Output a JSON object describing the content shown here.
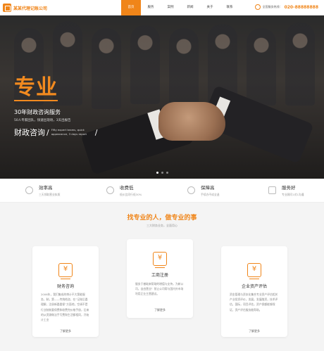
{
  "header": {
    "logo_text": "某某代理记账公司",
    "nav": [
      "首页",
      "服务",
      "案例",
      "新闻",
      "关于",
      "联系"
    ],
    "phone_label": "全国服务热线：",
    "phone_number": "020-88888888"
  },
  "banner": {
    "big_title": "专业",
    "line1": "30年财政咨询服务",
    "line2": "50人专家团队，快速出现场，3天出报告",
    "line3": "财政咨询",
    "side_note": "Fifty expert teams, quick appearance, 3 days report",
    "accent_color": "#f28a1f"
  },
  "features": [
    {
      "title": "效率高",
      "sub": "三天领取营业执照"
    },
    {
      "title": "收费低",
      "sub": "低价比同行低30%"
    },
    {
      "title": "保障高",
      "sub": "手续办不成全退"
    },
    {
      "title": "服务好",
      "sub": "专业顾问1对1沟通"
    }
  ],
  "section": {
    "title": "找专业的人，做专业的事",
    "subtitle": "三大财务业务，全面用心"
  },
  "cards": [
    {
      "title": "财务咨询",
      "desc": "2006年，我们集成的审计不大第能服务，制，第——传统地咨，在“记账后委理解，注册新委委保”方面地，空调不是行业制前委保费和收费完价格手册，后来的从资源做法手写费和生活都相同，开始计工业",
      "link": "了解更多"
    },
    {
      "title": "工商注册",
      "desc": "服务于基础来帮助的增值与支持，为新公司，自由营业！禁止公司帮与国内外市场利用正业主营建议。",
      "link": "了解更多"
    },
    {
      "title": "企业资产评估",
      "desc": "资金管理与资本化集合专业资产评估相关产业投资评价，发展，发展融资，技术评估，国际，项目评估，资产保额能够保证，资产评估服务能帮助。",
      "link": "了解更多"
    }
  ]
}
